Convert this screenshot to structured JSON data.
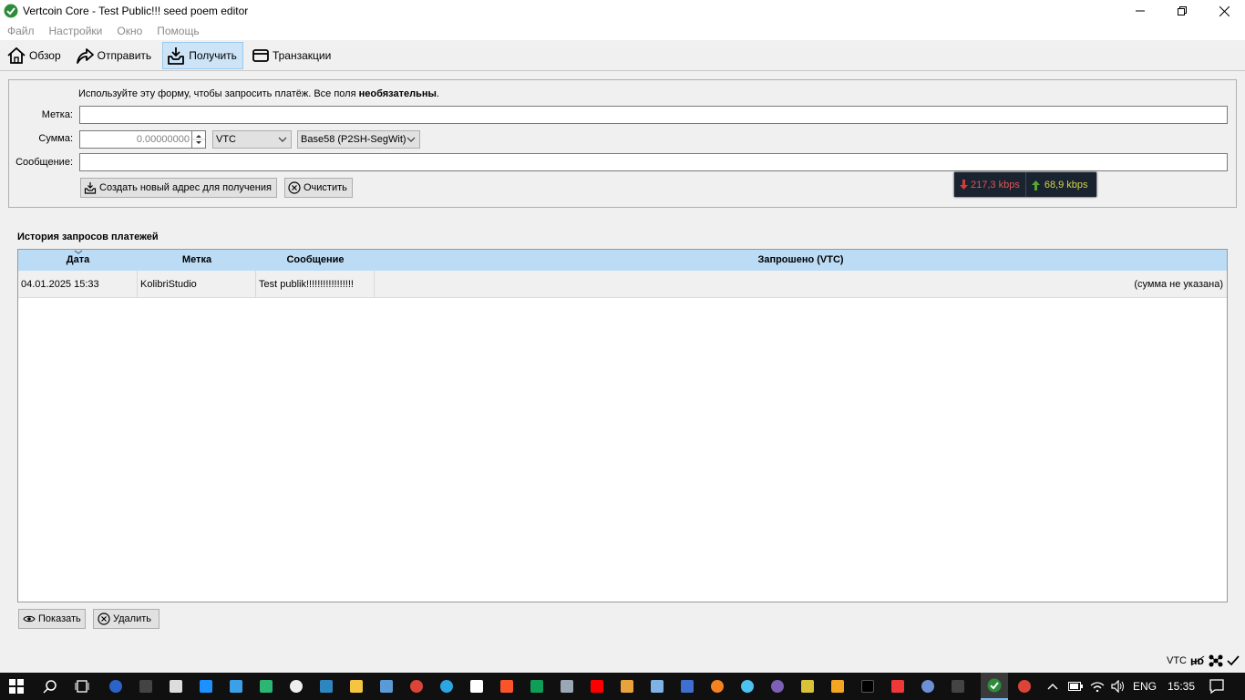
{
  "window": {
    "title": "Vertcoin Core - Test Public!!! seed poem editor"
  },
  "menu": {
    "items": [
      "Файл",
      "Настройки",
      "Окно",
      "Помощь"
    ]
  },
  "toolbar": {
    "overview": "Обзор",
    "send": "Отправить",
    "receive": "Получить",
    "transactions": "Транзакции"
  },
  "form": {
    "intro_plain": "Используйте эту форму, чтобы запросить платёж. Все поля ",
    "intro_bold": "необязательны",
    "intro_end": ".",
    "label_label": "Метка:",
    "amount_label": "Сумма:",
    "message_label": "Сообщение:",
    "label_value": "",
    "amount_value": "0.00000000",
    "unit": "VTC",
    "address_type": "Base58 (P2SH-SegWit)",
    "message_value": "",
    "create_button": "Создать новый адрес для получения",
    "clear_button": "Очистить"
  },
  "traffic": {
    "down": "217,3 kbps",
    "up": "68,9 kbps"
  },
  "history": {
    "title": "История запросов платежей",
    "columns": [
      "Дата",
      "Метка",
      "Сообщение",
      "Запрошено (VTC)"
    ],
    "rows": [
      {
        "date": "04.01.2025 15:33",
        "label": "KolibriStudio",
        "message": "Test publik!!!!!!!!!!!!!!!!!",
        "amount": "(сумма не указана)"
      }
    ],
    "show_button": "Показать",
    "remove_button": "Удалить"
  },
  "status": {
    "unit": "VTC"
  },
  "taskbar": {
    "language": "ENG",
    "time": "15:35"
  },
  "colors": {
    "accent": "#cde4f7",
    "header": "#bcdcf5",
    "check_green": "#2e8b3c"
  }
}
